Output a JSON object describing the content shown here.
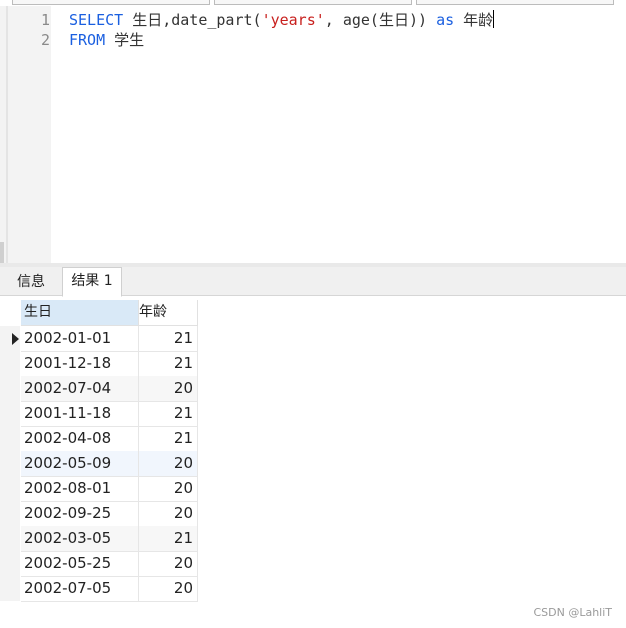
{
  "editor": {
    "lines": [
      {
        "number": "1",
        "segments": [
          {
            "t": "SELECT",
            "k": "kw"
          },
          {
            "t": " 生日,date_part(",
            "k": ""
          },
          {
            "t": "'years'",
            "k": "str"
          },
          {
            "t": ", age(生日)) ",
            "k": ""
          },
          {
            "t": "as",
            "k": "kw"
          },
          {
            "t": " 年龄",
            "k": ""
          }
        ]
      },
      {
        "number": "2",
        "segments": [
          {
            "t": "FROM",
            "k": "kw"
          },
          {
            "t": " 学生",
            "k": ""
          }
        ]
      }
    ]
  },
  "tabs": {
    "info": "信息",
    "result": "结果 1"
  },
  "table": {
    "headers": [
      "生日",
      "年龄"
    ],
    "rows": [
      [
        "2002-01-01",
        "21"
      ],
      [
        "2001-12-18",
        "21"
      ],
      [
        "2002-07-04",
        "20"
      ],
      [
        "2001-11-18",
        "21"
      ],
      [
        "2002-04-08",
        "21"
      ],
      [
        "2002-05-09",
        "20"
      ],
      [
        "2002-08-01",
        "20"
      ],
      [
        "2002-09-25",
        "20"
      ],
      [
        "2002-03-05",
        "21"
      ],
      [
        "2002-05-25",
        "20"
      ],
      [
        "2002-07-05",
        "20"
      ]
    ]
  },
  "watermark": "CSDN @LahliT"
}
